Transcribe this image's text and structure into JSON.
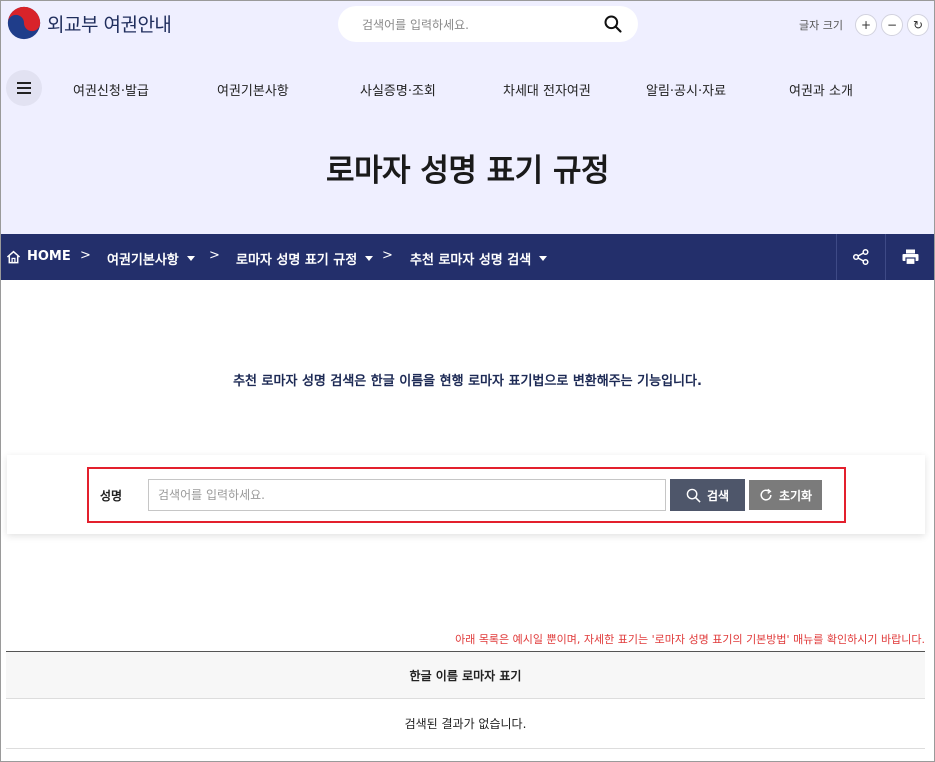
{
  "header": {
    "logo_text": "외교부 여권안내",
    "search_placeholder": "검색어를 입력하세요.",
    "font_size_label": "글자 크기",
    "font_increase": "+",
    "font_decrease": "−",
    "font_reset": "↻"
  },
  "gnb": {
    "items": [
      {
        "label": "여권신청·발급"
      },
      {
        "label": "여권기본사항"
      },
      {
        "label": "사실증명·조회"
      },
      {
        "label": "차세대 전자여권"
      },
      {
        "label": "알림·공시·자료"
      },
      {
        "label": "여권과 소개"
      }
    ]
  },
  "page": {
    "title": "로마자 성명 표기 규정"
  },
  "breadcrumb": {
    "home": "HOME",
    "items": [
      {
        "label": "여권기본사항"
      },
      {
        "label": "로마자 성명 표기 규정"
      },
      {
        "label": "추천 로마자 성명 검색"
      }
    ],
    "separator": ">"
  },
  "main": {
    "intro": "추천 로마자 성명 검색은 한글 이름을 현행 로마자 표기법으로 변환해주는 기능입니다.",
    "form": {
      "name_label": "성명",
      "input_placeholder": "검색어를 입력하세요.",
      "input_value": "",
      "search_button": "검색",
      "reset_button": "초기화"
    },
    "notice": "아래 목록은 예시일 뿐이며, 자세한 표기는 '로마자 성명 표기의 기본방법' 매뉴를 확인하시기 바랍니다.",
    "table": {
      "header": "한글 이름 로마자 표기",
      "empty_message": "검색된 결과가 없습니다."
    }
  },
  "colors": {
    "header_bg": "#efefff",
    "breadcrumb_bg": "#232f6b",
    "highlight_border": "#e3202d",
    "search_button_bg": "#4e566a",
    "reset_button_bg": "#7b7b7b",
    "notice_text": "#e03a3a"
  }
}
